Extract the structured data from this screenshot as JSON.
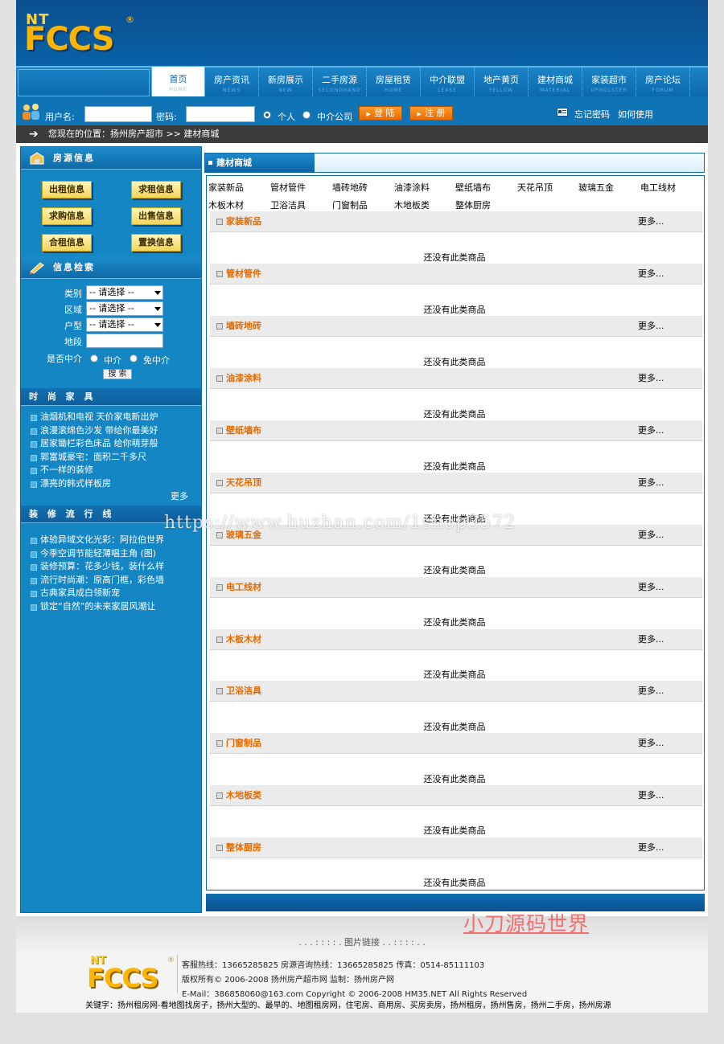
{
  "logo": {
    "small": "NT",
    "big": "FCCS",
    "reg": "®"
  },
  "nav": [
    {
      "zh": "首页",
      "en": "HOME"
    },
    {
      "zh": "房产资讯",
      "en": "NEWS"
    },
    {
      "zh": "新房展示",
      "en": "NEW"
    },
    {
      "zh": "二手房源",
      "en": "SECONDHAND"
    },
    {
      "zh": "房屋租赁",
      "en": "HOME"
    },
    {
      "zh": "中介联盟",
      "en": "LEASE"
    },
    {
      "zh": "地产黄页",
      "en": "YELLOW"
    },
    {
      "zh": "建材商城",
      "en": "MATERIAL"
    },
    {
      "zh": "家装超市",
      "en": "UPHOLSTER"
    },
    {
      "zh": "房产论坛",
      "en": "FORUM"
    }
  ],
  "login": {
    "user_label": "用户名:",
    "pass_label": "密码:",
    "opt_personal": "个人",
    "opt_agency": "中介公司",
    "login_btn": "登 陆",
    "register_btn": "注 册",
    "forgot": "忘记密码",
    "howto": "如何使用"
  },
  "breadcrumb": "您现在的位置：扬州房产超市 >> 建材商城",
  "left": {
    "house_title": "房源信息",
    "house_buttons": [
      "出租信息",
      "求租信息",
      "求购信息",
      "出售信息",
      "合租信息",
      "置换信息"
    ],
    "search_title": "信息检索",
    "search_labels": [
      "类别",
      "区域",
      "户型",
      "地段",
      "是否中介"
    ],
    "select_text": "-- 请选择 --",
    "agent_options": [
      "中介",
      "免中介"
    ],
    "search_btn": "搜 索",
    "fashion_title": "时 尚 家 具",
    "fashion_items": [
      "油烟机和电视 天价家电新出炉",
      "浪漫滚绵色沙发 带给你最美好",
      "居家锄栏彩色床品 给你萌芽般",
      "郭富城豪宅：面积二千多尺",
      "不一样的装修",
      "漂亮的韩式样板房"
    ],
    "fashion_more": "更多",
    "trend_title": "装 修 流 行 线",
    "trend_items": [
      "体验异域文化光彩：阿拉伯世界",
      "今季空调节能轻薄唱主角 (图)",
      "装修预算：花多少钱，装什么样",
      "流行时尚潮：原高门框，彩色墙",
      "古典家具成白领新宠",
      "锁定“自然”的未来家居风潮让"
    ]
  },
  "main": {
    "title": "建材商城",
    "categories": [
      "家装新品",
      "管材管件",
      "墙砖地砖",
      "油漆涂料",
      "壁纸墙布",
      "天花吊顶",
      "玻璃五金",
      "电工线材",
      "木板木材",
      "卫浴洁具",
      "门窗制品",
      "木地板类",
      "整体厨房"
    ],
    "sections": [
      "家装新品",
      "管材管件",
      "墙砖地砖",
      "油漆涂料",
      "壁纸墙布",
      "天花吊顶",
      "玻璃五金",
      "电工线材",
      "木板木材",
      "卫浴洁具",
      "门窗制品",
      "木地板类",
      "整体厨房"
    ],
    "more": "更多...",
    "empty_text": "还没有此类商品"
  },
  "watermark": "https://www.huzhan.com/1shop3572",
  "watermark2": "小刀源码世界",
  "footer": {
    "piclink": ". . . : : : : .   图片链接   . . : : : : . .",
    "line1": "客服热线：13665285825    房源咨询热线：13665285825    传真：0514-85111103",
    "line2": "版权所有© 2006-2008  扬州房产超市网  监制：扬州房产网",
    "line3": "E-Mail：386858060@163.com    Copyright © 2006-2008 HM35.NET  All Rights Reserved",
    "keywords": "关键字：扬州租房网-看地图找房子，扬州大型的、最早的、地图租房网，住宅房、商用房、买房卖房，扬州租房，扬州售房，扬州二手房，扬州房源"
  },
  "colors": {
    "brand_blue": "#0f74b6",
    "accent_orange": "#e26a00",
    "dark_bar": "#3b3b3b"
  }
}
